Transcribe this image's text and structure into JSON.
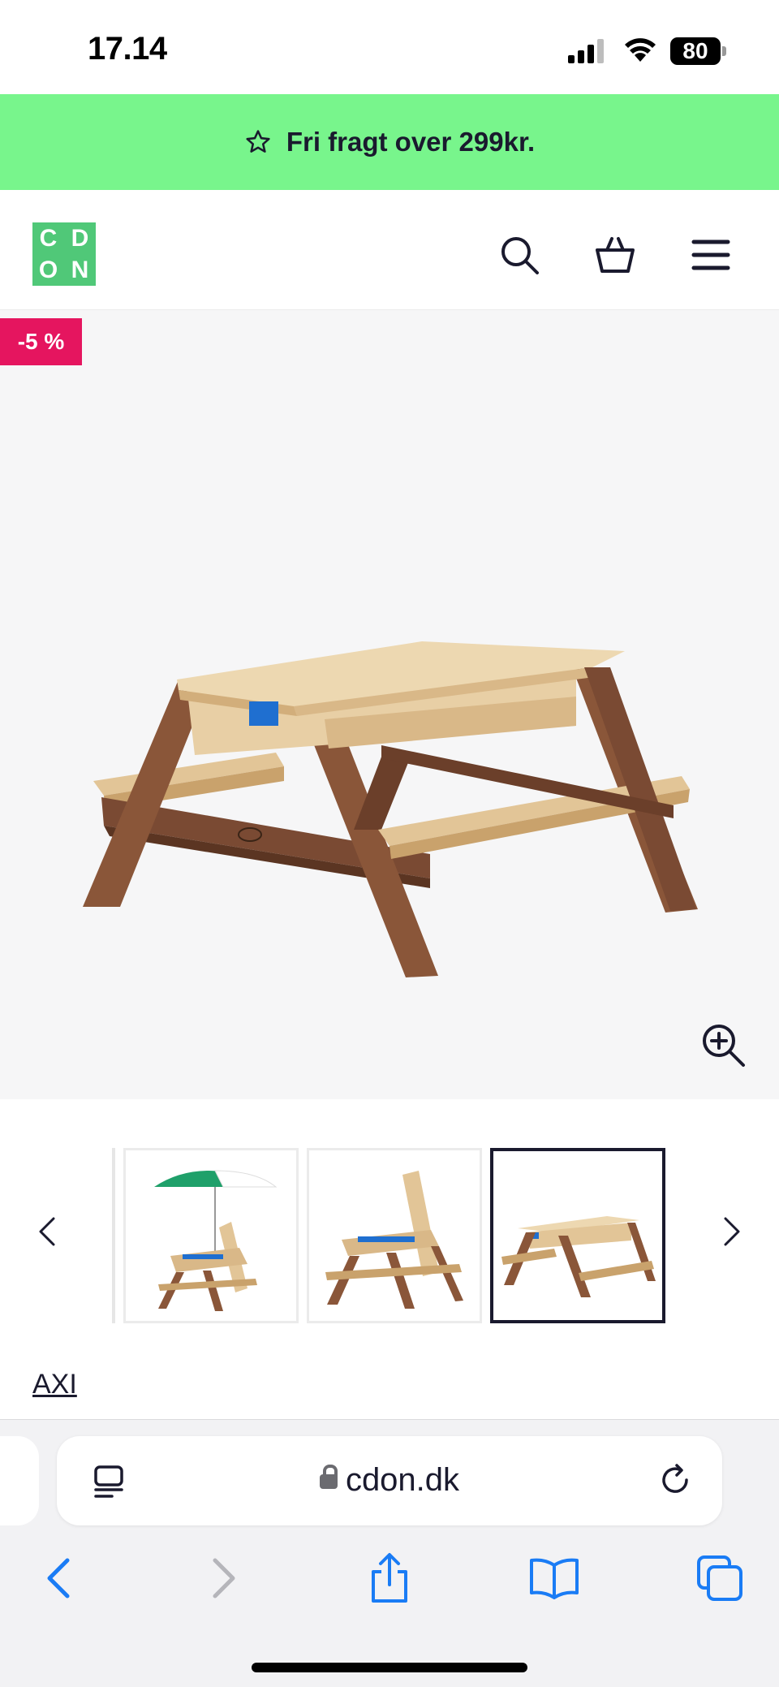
{
  "status_bar": {
    "time": "17.14",
    "battery": "80"
  },
  "promo": {
    "text": "Fri fragt over 299kr."
  },
  "header": {
    "logo_letters": [
      "C",
      "D",
      "O",
      "N"
    ],
    "icons": [
      "search-icon",
      "basket-icon",
      "menu-icon"
    ]
  },
  "product": {
    "discount_badge": "-5 %",
    "brand": "AXI",
    "thumbnail_count": 3,
    "active_thumbnail": 3
  },
  "browser": {
    "url": "cdon.dk",
    "toolbar_icons": [
      "back-icon",
      "forward-icon",
      "share-icon",
      "bookmarks-icon",
      "tabs-icon"
    ]
  },
  "colors": {
    "promo_bg": "#78f58c",
    "logo_bg": "#50c878",
    "discount_bg": "#e5155f",
    "ios_blue": "#1a7cf5"
  }
}
